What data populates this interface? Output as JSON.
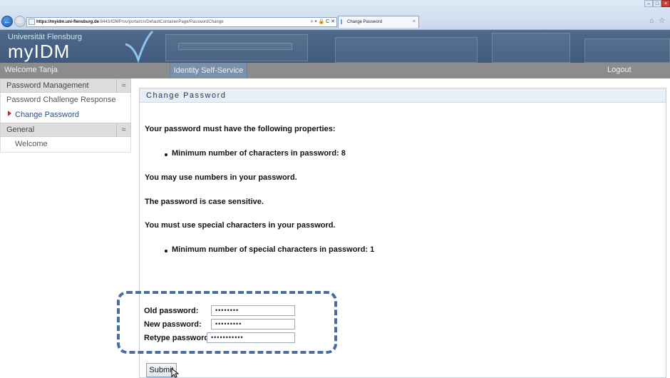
{
  "browser": {
    "url_host": "https://myidm.uni-flensburg.de",
    "url_rest": ":8443/IDMProv/portal/cn/DefaultContainerPage/PasswordChange",
    "address_tools": "⌕ ▾ 🔒 C ✕",
    "tab_title": "Change Password",
    "tab_close": "×",
    "home_icons": "⌂ ☆"
  },
  "header": {
    "university": "Universität Flensburg",
    "app_name": "myIDM"
  },
  "menubar": {
    "welcome": "Welcome Tanja",
    "active_tab": "Identity Self-Service",
    "logout": "Logout"
  },
  "sidebar": {
    "sections": [
      {
        "title": "Password Management",
        "toggle": "≈",
        "items": [
          "Password Challenge Response",
          "Change Password"
        ]
      },
      {
        "title": "General",
        "toggle": "≈",
        "items": [
          "Welcome"
        ]
      }
    ],
    "active_item": "Change Password"
  },
  "main": {
    "title": "Change Password",
    "intro": "Your password must have the following properties:",
    "rule_min_chars": "Minimum number of characters in password: 8",
    "numbers_note": "You may use numbers in your password.",
    "case_note": "The password is case sensitive.",
    "special_note": "You must use special characters in your password.",
    "rule_min_special": "Minimum number of special characters in password: 1"
  },
  "form": {
    "old_label": "Old password:",
    "old_value": "••••••••",
    "new_label": "New password:",
    "new_value": "•••••••••",
    "retype_label": "Retype password:",
    "retype_value": "•••••••••••",
    "submit_label": "Submit"
  },
  "colors": {
    "banner": "#4a6586",
    "menubar": "#8c8c8c",
    "active_tab": "#7b91ab",
    "highlight_box": "#4a6d9d",
    "active_marker": "#cc2b2b"
  }
}
